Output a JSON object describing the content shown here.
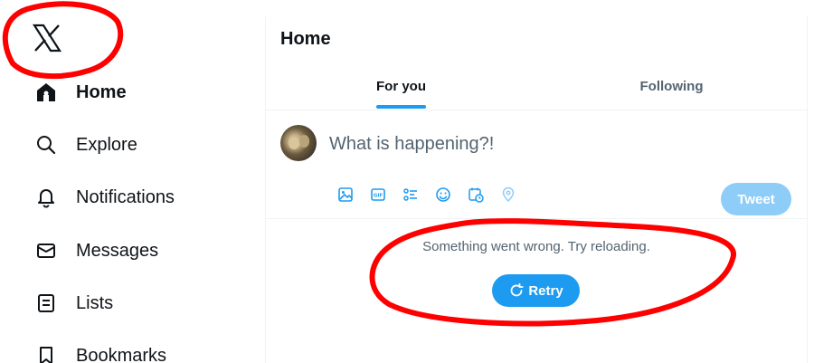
{
  "sidebar": {
    "logo": "x-logo-icon",
    "items": [
      {
        "label": "Home",
        "icon": "home-icon",
        "active": true
      },
      {
        "label": "Explore",
        "icon": "search-icon"
      },
      {
        "label": "Notifications",
        "icon": "bell-icon"
      },
      {
        "label": "Messages",
        "icon": "envelope-icon"
      },
      {
        "label": "Lists",
        "icon": "list-icon"
      },
      {
        "label": "Bookmarks",
        "icon": "bookmark-icon"
      }
    ]
  },
  "main": {
    "title": "Home",
    "tabs": [
      {
        "label": "For you",
        "active": true
      },
      {
        "label": "Following"
      }
    ],
    "composer": {
      "placeholder": "What is happening?!",
      "tools": [
        "image-icon",
        "gif-icon",
        "poll-icon",
        "emoji-icon",
        "schedule-icon",
        "location-icon"
      ],
      "tweet_label": "Tweet"
    },
    "error": {
      "message": "Something went wrong. Try reloading.",
      "retry_label": "Retry"
    }
  },
  "colors": {
    "accent": "#1d9bf0",
    "tweet_disabled": "#8ecdf8",
    "annotation": "#ff0000"
  }
}
